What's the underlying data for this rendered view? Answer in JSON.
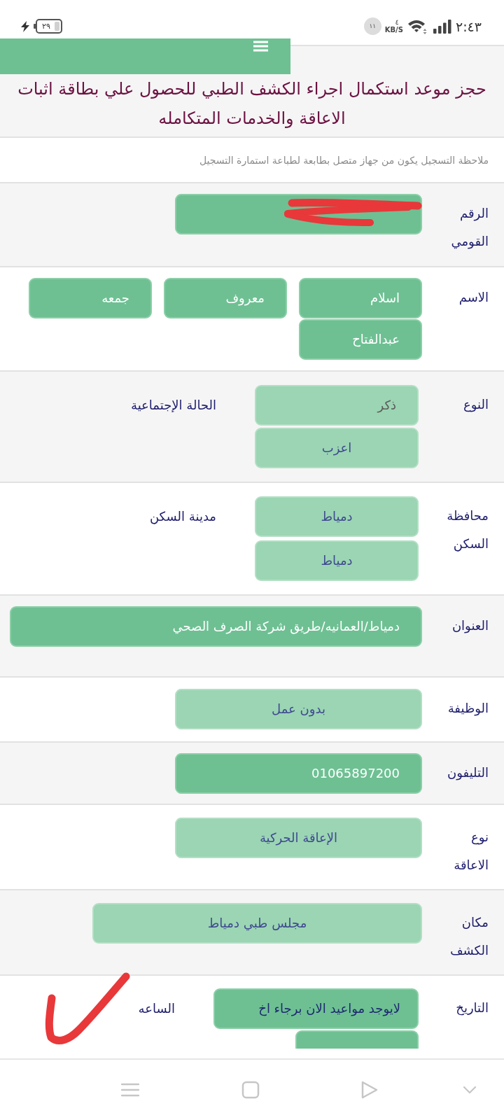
{
  "status_bar": {
    "time": "٢:٤٣",
    "net_speed_value": "٤",
    "net_speed_unit": "KB/S",
    "notification_count": "١١",
    "battery": "٢٩",
    "charging": true
  },
  "header": {
    "title": "حجز موعد استكمال اجراء الكشف الطبي للحصول علي بطاقة اثبات الاعاقة والخدمات المتكامله"
  },
  "note": "ملاحظة التسجيل يكون من جهاز متصل بطابعة لطباعة استمارة التسجيل",
  "form": {
    "rows": [
      {
        "label": "الرقم القومي",
        "fields": [
          {
            "kind": "input",
            "redacted": true
          }
        ]
      },
      {
        "label": "الاسم",
        "fields": [
          {
            "kind": "input",
            "value": "اسلام"
          },
          {
            "kind": "input",
            "value": "معروف"
          },
          {
            "kind": "input",
            "value": "جمعه"
          },
          {
            "kind": "input",
            "value": "عبدالفتاح"
          }
        ]
      },
      {
        "label": "النوع",
        "side_label": "الحالة الإجتماعية",
        "fields": [
          {
            "kind": "readonly",
            "value": "ذكر"
          },
          {
            "kind": "select",
            "value": "اعزب"
          }
        ]
      },
      {
        "label": "محافظة السكن",
        "side_label": "مدينة السكن",
        "fields": [
          {
            "kind": "select",
            "value": "دمياط"
          },
          {
            "kind": "select",
            "value": "دمياط"
          }
        ]
      },
      {
        "label": "العنوان",
        "fields": [
          {
            "kind": "input",
            "value": "دمياط/العمانيه/طريق شركة الصرف الصحي"
          }
        ]
      },
      {
        "label": "الوظيفة",
        "fields": [
          {
            "kind": "select",
            "value": "بدون عمل"
          }
        ]
      },
      {
        "label": "التليفون",
        "fields": [
          {
            "kind": "input",
            "value": "01065897200"
          }
        ]
      },
      {
        "label": "نوع الاعاقة",
        "fields": [
          {
            "kind": "select",
            "value": "الإعاقة الحركية"
          }
        ]
      },
      {
        "label": "مكان الكشف",
        "fields": [
          {
            "kind": "select",
            "value": "مجلس طبي دمياط"
          }
        ]
      },
      {
        "label": "التاريخ",
        "side_label": "الساعه",
        "fields": [
          {
            "kind": "date",
            "value": "لايوجد مواعيد الان برجاء اخ"
          },
          {
            "kind": "date"
          }
        ]
      }
    ]
  }
}
